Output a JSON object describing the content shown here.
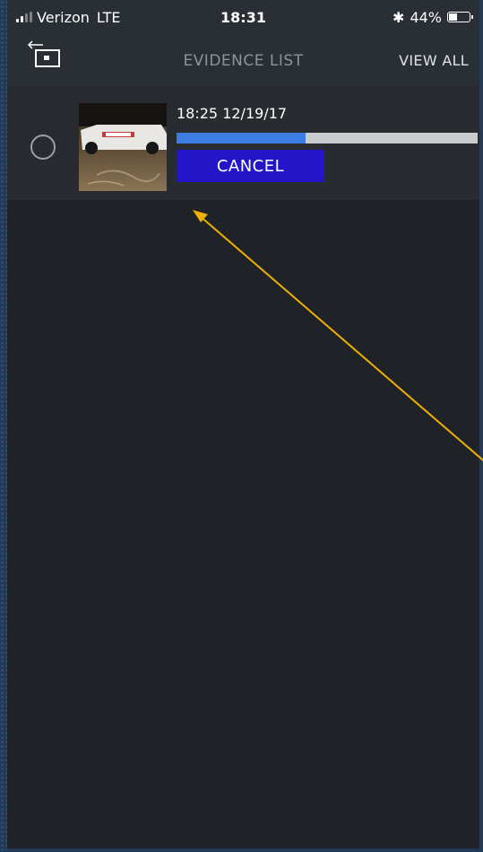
{
  "status_bar": {
    "carrier": "Verizon",
    "network": "LTE",
    "time": "18:31",
    "bluetooth_icon": "bluetooth-icon",
    "battery_text": "44%",
    "battery_level": 0.44
  },
  "nav": {
    "back_icon": "camera-back-icon",
    "title": "EVIDENCE LIST",
    "view_all_label": "VIEW ALL"
  },
  "evidence_items": [
    {
      "timestamp": "18:25 12/19/17",
      "upload_progress": 0.43,
      "cancel_label": "CANCEL"
    }
  ],
  "colors": {
    "background": "#1f2327",
    "bar": "#2a2f35",
    "progress_fill": "#3b7de2",
    "progress_track": "#c9cccf",
    "cancel_button": "#2315c8",
    "annotation_arrow": "#f0b000"
  }
}
